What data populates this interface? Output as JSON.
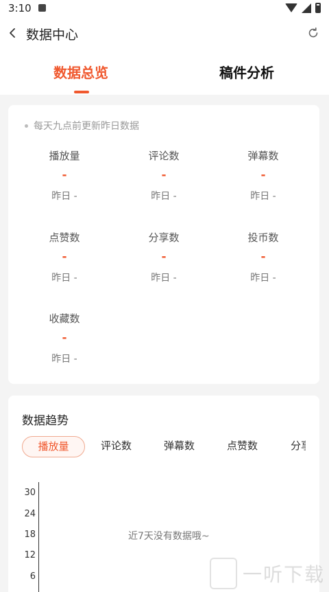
{
  "status_bar": {
    "time": "3:10"
  },
  "appbar": {
    "title": "数据中心"
  },
  "tabs": [
    {
      "label": "数据总览",
      "active": true
    },
    {
      "label": "稿件分析",
      "active": false
    }
  ],
  "overview": {
    "notice": "每天九点前更新昨日数据",
    "stats": [
      {
        "label": "播放量",
        "value": "-",
        "prev": "昨日 -"
      },
      {
        "label": "评论数",
        "value": "-",
        "prev": "昨日 -"
      },
      {
        "label": "弹幕数",
        "value": "-",
        "prev": "昨日 -"
      },
      {
        "label": "点赞数",
        "value": "-",
        "prev": "昨日 -"
      },
      {
        "label": "分享数",
        "value": "-",
        "prev": "昨日 -"
      },
      {
        "label": "投币数",
        "value": "-",
        "prev": "昨日 -"
      },
      {
        "label": "收藏数",
        "value": "-",
        "prev": "昨日 -"
      }
    ]
  },
  "trend": {
    "title": "数据趋势",
    "chips": [
      "播放量",
      "评论数",
      "弹幕数",
      "点赞数",
      "分享数"
    ],
    "selected_chip": "播放量",
    "y_ticks": [
      "30",
      "24",
      "18",
      "12",
      "6"
    ],
    "empty_text": "近7天没有数据哦~"
  },
  "watermark": {
    "text": "一听下载"
  },
  "colors": {
    "accent": "#f0582e"
  }
}
